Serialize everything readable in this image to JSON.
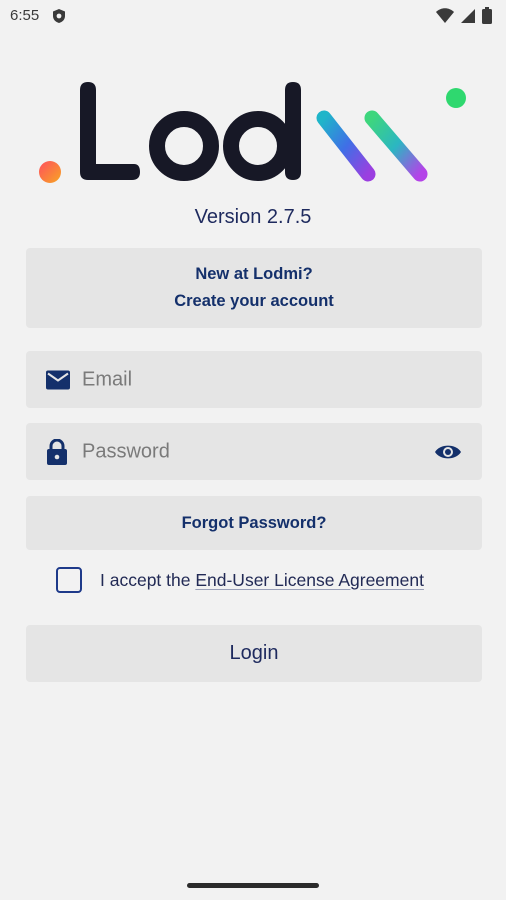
{
  "status_bar": {
    "time": "6:55"
  },
  "app": {
    "logo_text": ".Lodmi",
    "version": "Version 2.7.5"
  },
  "signup": {
    "line1": "New at Lodmi?",
    "line2": "Create your account"
  },
  "form": {
    "email_placeholder": "Email",
    "password_placeholder": "Password",
    "forgot_label": "Forgot Password?",
    "eula_prefix": "I accept the ",
    "eula_link": "End-User License Agreement",
    "eula_checked": false,
    "login_label": "Login"
  },
  "colors": {
    "accent": "#14306b",
    "field_bg": "#e5e5e5",
    "background": "#f2f2f2"
  },
  "icons": {
    "email": "mail-icon",
    "password": "lock-icon",
    "toggle": "eye-icon"
  }
}
